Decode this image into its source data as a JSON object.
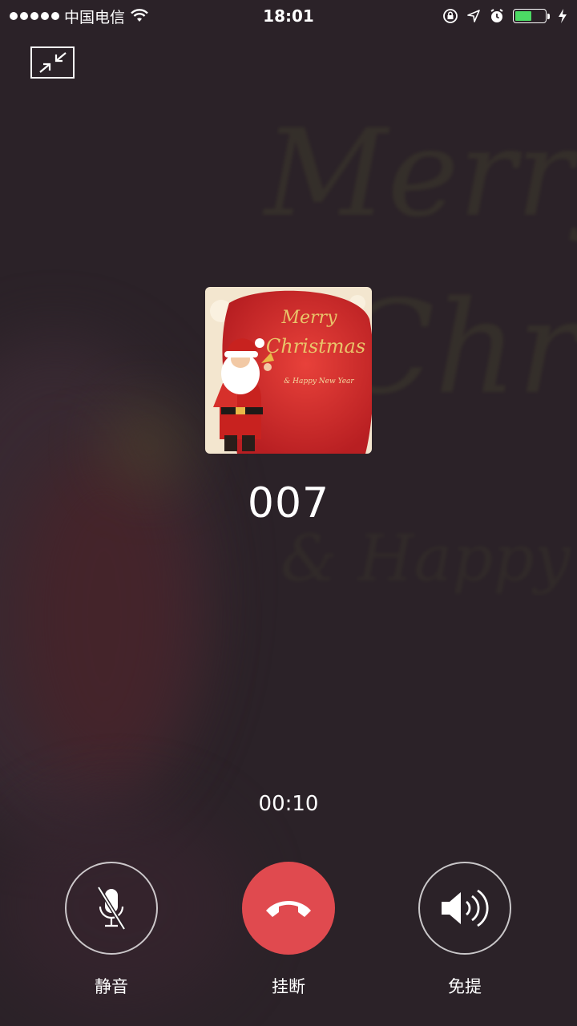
{
  "status_bar": {
    "carrier": "中国电信",
    "time": "18:01",
    "battery_level": 0.55,
    "battery_color": "#4cd964"
  },
  "call": {
    "caller_name": "007",
    "duration": "00:10",
    "avatar": {
      "title_line1": "Merry",
      "title_line2": "Christmas",
      "subtitle": "& Happy New Year"
    }
  },
  "controls": {
    "mute_label": "静音",
    "hangup_label": "挂断",
    "speaker_label": "免提",
    "hangup_color": "#e04a4f"
  },
  "icons": [
    "signal-icon",
    "wifi-icon",
    "orientation-lock-icon",
    "location-icon",
    "alarm-icon",
    "battery-icon",
    "charging-icon",
    "minimize-icon",
    "mic-off-icon",
    "hangup-phone-icon",
    "speaker-icon"
  ]
}
